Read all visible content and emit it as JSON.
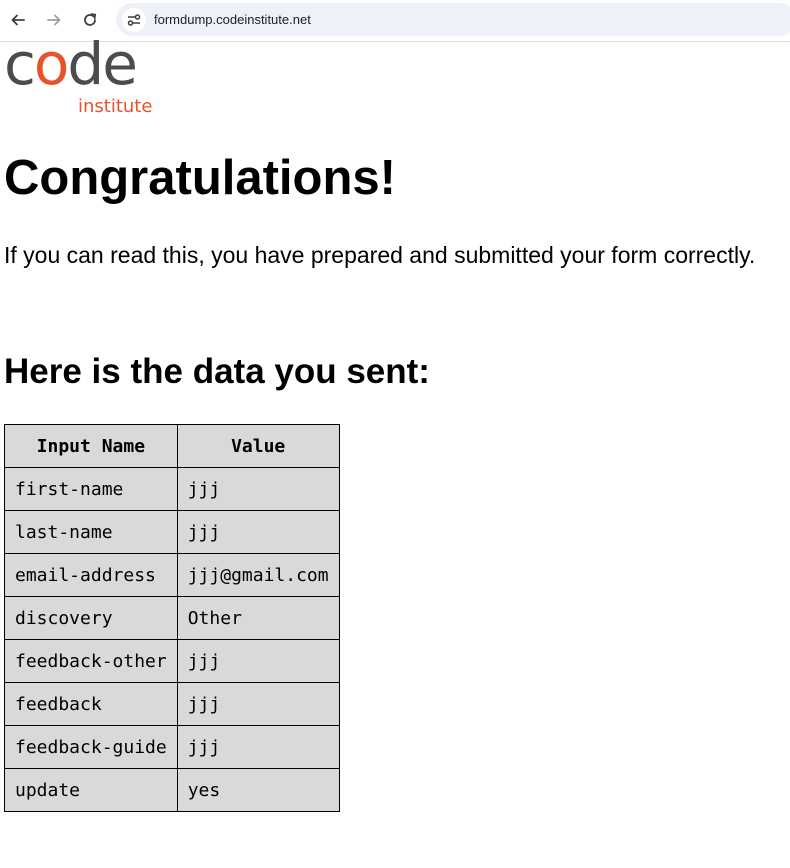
{
  "browser": {
    "url": "formdump.codeinstitute.net"
  },
  "logo": {
    "word_left": "c",
    "word_o": "o",
    "word_right": "de",
    "subtitle": "institute"
  },
  "page": {
    "heading": "Congratulations!",
    "intro": "If you can read this, you have prepared and submitted your form correctly.",
    "subheading": "Here is the data you sent:"
  },
  "table": {
    "headers": [
      "Input Name",
      "Value"
    ],
    "rows": [
      {
        "name": "first-name",
        "value": "jjj"
      },
      {
        "name": "last-name",
        "value": "jjj"
      },
      {
        "name": "email-address",
        "value": "jjj@gmail.com"
      },
      {
        "name": "discovery",
        "value": "Other"
      },
      {
        "name": "feedback-other",
        "value": "jjj"
      },
      {
        "name": "feedback",
        "value": "jjj"
      },
      {
        "name": "feedback-guide",
        "value": "jjj"
      },
      {
        "name": "update",
        "value": "yes"
      }
    ]
  }
}
